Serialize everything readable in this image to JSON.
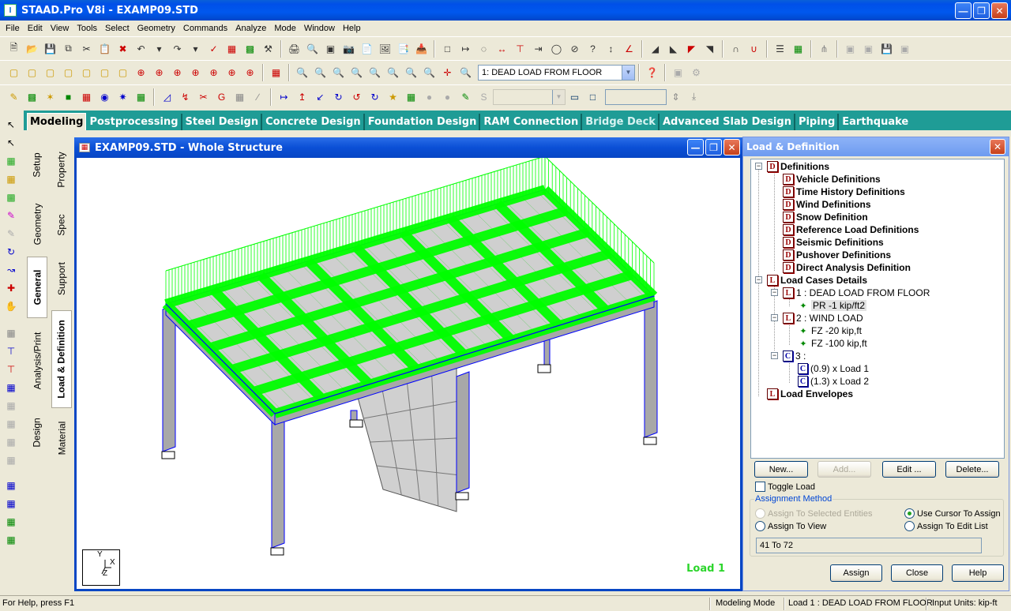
{
  "app": {
    "title": "STAAD.Pro V8i - EXAMP09.STD"
  },
  "menu": [
    "File",
    "Edit",
    "View",
    "Tools",
    "Select",
    "Geometry",
    "Commands",
    "Analyze",
    "Mode",
    "Window",
    "Help"
  ],
  "toolbar": {
    "load_case_combo": "1: DEAD LOAD FROM FLOOR",
    "help_glyph": "?"
  },
  "page_tabs": [
    "Modeling",
    "Postprocessing",
    "Steel Design",
    "Concrete Design",
    "Foundation Design",
    "RAM Connection",
    "Bridge Deck",
    "Advanced Slab Design",
    "Piping",
    "Earthquake"
  ],
  "vertical_tabs_outer": [
    "Setup",
    "Geometry",
    "General",
    "Analysis/Print",
    "Design"
  ],
  "vertical_tabs_inner": [
    "Property",
    "Spec",
    "Support",
    "Load & Definition",
    "Material"
  ],
  "document": {
    "title": "EXAMP09.STD - Whole Structure",
    "load_label": "Load 1",
    "axis_y": "Y",
    "axis_x": "X",
    "axis_z": "Z"
  },
  "panel": {
    "title": "Load & Definition",
    "tree": {
      "definitions": "Definitions",
      "vehicle": "Vehicle Definitions",
      "time_history": "Time History Definitions",
      "wind": "Wind Definitions",
      "snow": "Snow Definition",
      "reference_load": "Reference Load Definitions",
      "seismic": "Seismic Definitions",
      "pushover": "Pushover Definitions",
      "direct_analysis": "Direct Analysis Definition",
      "load_cases": "Load Cases Details",
      "case1": "1 : DEAD LOAD FROM FLOOR",
      "case1_item": "PR -1  kip/ft2",
      "case2": "2 : WIND LOAD",
      "case2_item1": "FZ -20 kip,ft",
      "case2_item2": "FZ -100 kip,ft",
      "case3": "3 :",
      "case3_item1": "(0.9) x Load 1",
      "case3_item2": "(1.3) x Load 2",
      "envelopes": "Load Envelopes"
    },
    "buttons": {
      "new": "New...",
      "add": "Add...",
      "edit": "Edit ...",
      "delete": "Delete...",
      "assign": "Assign",
      "close": "Close",
      "help": "Help"
    },
    "toggle_load": "Toggle Load",
    "assignment_method": "Assignment Method",
    "assign_selected": "Assign To Selected Entities",
    "use_cursor": "Use Cursor To Assign",
    "assign_view": "Assign To View",
    "assign_edit_list": "Assign To Edit List",
    "edit_list_value": "41 To 72"
  },
  "status": {
    "help": "For Help, press F1",
    "mode": "Modeling Mode",
    "load": "Load 1 : DEAD LOAD FROM FLOOR",
    "units": "Input Units:   kip-ft"
  },
  "colors": {
    "load_green": "#00ff00",
    "member_blue": "#0000ff",
    "column_grey": "#a8a8a8",
    "tab_teal": "#1f9c96"
  }
}
